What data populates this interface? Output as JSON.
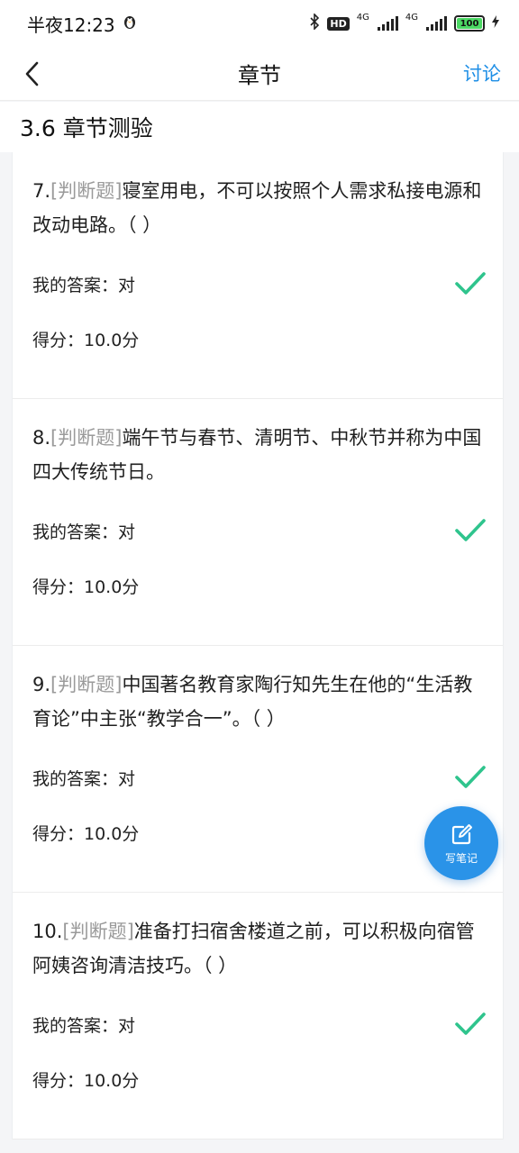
{
  "status_bar": {
    "time": "半夜12:23",
    "network_1": "4G",
    "network_2": "4G",
    "battery": "100",
    "hd_label": "HD"
  },
  "nav": {
    "title": "章节",
    "discuss_label": "讨论"
  },
  "section": {
    "title": "3.6 章节测验"
  },
  "questions": [
    {
      "number": "7.",
      "type": "[判断题]",
      "text": "寝室用电，不可以按照个人需求私接电源和改动电路。（ ）",
      "answer": "我的答案：对",
      "score": "得分：10.0分",
      "result_icon": "check-icon"
    },
    {
      "number": "8.",
      "type": "[判断题]",
      "text": "端午节与春节、清明节、中秋节并称为中国四大传统节日。",
      "answer": "我的答案：对",
      "score": "得分：10.0分",
      "result_icon": "check-icon"
    },
    {
      "number": "9.",
      "type": "[判断题]",
      "text": "中国著名教育家陶行知先生在他的“生活教育论”中主张“教学合一”。（ ）",
      "answer": "我的答案：对",
      "score": "得分：10.0分",
      "result_icon": "check-icon"
    },
    {
      "number": "10.",
      "type": "[判断题]",
      "text": "准备打扫宿舍楼道之前，可以积极向宿管阿姨咨询清洁技巧。（ ）",
      "answer": "我的答案：对",
      "score": "得分：10.0分",
      "result_icon": "check-icon"
    }
  ],
  "fab": {
    "label": "写笔记",
    "icon": "edit-note-icon"
  },
  "colors": {
    "accent": "#1d8ee6",
    "fab": "#2a93e8",
    "check": "#2fc48d",
    "question_type": "#9a9a9a"
  }
}
